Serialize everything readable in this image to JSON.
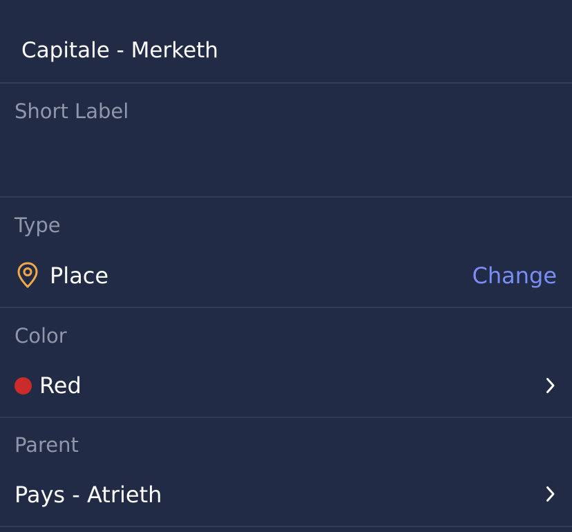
{
  "header": {
    "title": "Capitale - Merketh"
  },
  "short_label": {
    "label": "Short Label",
    "value": ""
  },
  "type": {
    "label": "Type",
    "value": "Place",
    "icon": "map-pin-icon",
    "icon_color": "#f0a94b",
    "action_label": "Change"
  },
  "color": {
    "label": "Color",
    "value": "Red",
    "swatch": "#cc2b2b"
  },
  "parent": {
    "label": "Parent",
    "value": "Pays - Atrieth"
  },
  "theme": {
    "background": "#222b45",
    "divider": "#323c59",
    "label_color": "#8f97ab",
    "link_color": "#7b8ef5"
  }
}
